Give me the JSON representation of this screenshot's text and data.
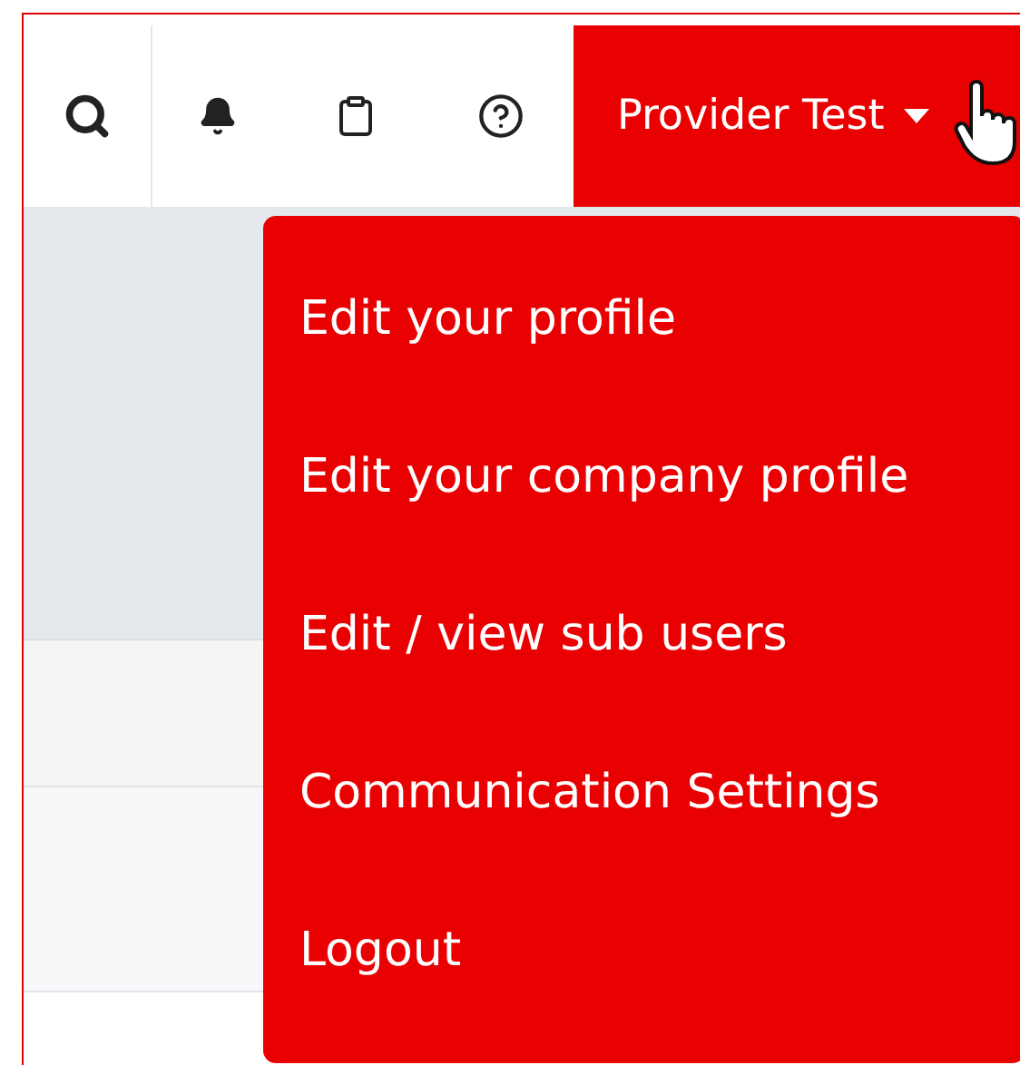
{
  "header": {
    "user_button": {
      "label": "Provider Test",
      "expanded": true
    }
  },
  "user_menu": {
    "items": [
      {
        "label": "Edit your profile"
      },
      {
        "label": "Edit your company profile"
      },
      {
        "label": "Edit / view sub users"
      },
      {
        "label": "Communication Settings"
      },
      {
        "label": "Logout"
      }
    ]
  }
}
